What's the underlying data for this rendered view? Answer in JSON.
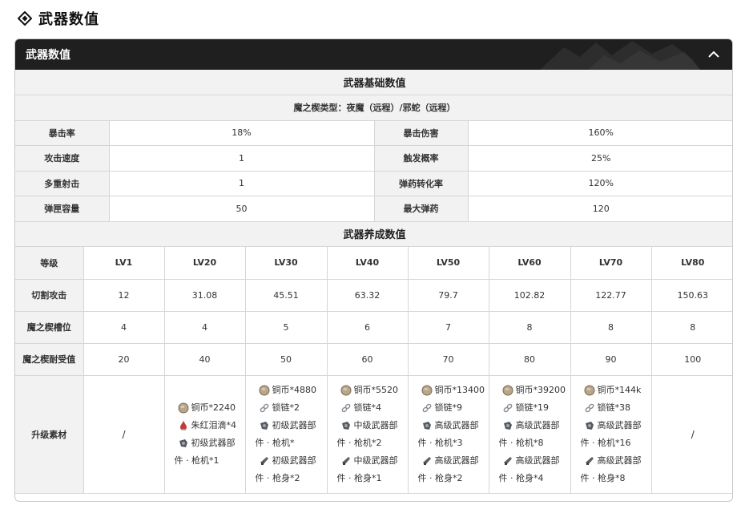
{
  "page": {
    "title": "武器数值"
  },
  "panel": {
    "title": "武器数值",
    "base_section_title": "武器基础数值",
    "type_line": "魔之楔类型：夜魔（远程）/邪蛇（远程）",
    "base_stats": [
      {
        "left_label": "暴击率",
        "left_value": "18%",
        "right_label": "暴击伤害",
        "right_value": "160%"
      },
      {
        "left_label": "攻击速度",
        "left_value": "1",
        "right_label": "触发概率",
        "right_value": "25%"
      },
      {
        "left_label": "多重射击",
        "left_value": "1",
        "right_label": "弹药转化率",
        "right_value": "120%"
      },
      {
        "left_label": "弹匣容量",
        "left_value": "50",
        "right_label": "最大弹药",
        "right_value": "120"
      }
    ],
    "growth_section_title": "武器养成数值",
    "growth": {
      "level_label": "等级",
      "levels": [
        "LV1",
        "LV20",
        "LV30",
        "LV40",
        "LV50",
        "LV60",
        "LV70",
        "LV80"
      ],
      "rows": [
        {
          "label": "切割攻击",
          "values": [
            "12",
            "31.08",
            "45.51",
            "63.32",
            "79.7",
            "102.82",
            "122.77",
            "150.63"
          ]
        },
        {
          "label": "魔之楔槽位",
          "values": [
            "4",
            "4",
            "5",
            "6",
            "7",
            "8",
            "8",
            "8"
          ]
        },
        {
          "label": "魔之楔耐受值",
          "values": [
            "20",
            "40",
            "50",
            "60",
            "70",
            "80",
            "90",
            "100"
          ]
        }
      ],
      "materials_label": "升级素材",
      "materials": [
        {
          "empty": "/"
        },
        {
          "items": [
            {
              "icon": "coin-icon",
              "text": "铜币*2240"
            },
            {
              "icon": "red-tear-icon",
              "text": "朱红泪滴*4"
            },
            {
              "icon": "trigger-part-icon",
              "text": "初级武器部",
              "text2": "件 · 枪机*1"
            }
          ]
        },
        {
          "items": [
            {
              "icon": "coin-icon",
              "text": "铜币*4880"
            },
            {
              "icon": "chain-icon",
              "text": "锁链*2"
            },
            {
              "icon": "trigger-part-icon",
              "text": "初级武器部",
              "text2": "件 · 枪机*"
            },
            {
              "icon": "barrel-part-icon",
              "text": "初级武器部",
              "text2": "件 · 枪身*2"
            }
          ]
        },
        {
          "items": [
            {
              "icon": "coin-icon",
              "text": "铜币*5520"
            },
            {
              "icon": "chain-icon",
              "text": "锁链*4"
            },
            {
              "icon": "trigger-part-icon",
              "text": "中级武器部",
              "text2": "件 · 枪机*2"
            },
            {
              "icon": "barrel-part-icon",
              "text": "中级武器部",
              "text2": "件 · 枪身*1"
            }
          ]
        },
        {
          "items": [
            {
              "icon": "coin-icon",
              "text": "铜币*13400"
            },
            {
              "icon": "chain-icon",
              "text": "锁链*9"
            },
            {
              "icon": "trigger-part-icon",
              "text": "高级武器部",
              "text2": "件 · 枪机*3"
            },
            {
              "icon": "barrel-part-icon",
              "text": "高级武器部",
              "text2": "件 · 枪身*2"
            }
          ]
        },
        {
          "items": [
            {
              "icon": "coin-icon",
              "text": "铜币*39200"
            },
            {
              "icon": "chain-icon",
              "text": "锁链*19"
            },
            {
              "icon": "trigger-part-icon",
              "text": "高级武器部",
              "text2": "件 · 枪机*8"
            },
            {
              "icon": "barrel-part-icon",
              "text": "高级武器部",
              "text2": "件 · 枪身*4"
            }
          ]
        },
        {
          "items": [
            {
              "icon": "coin-icon",
              "text": "铜币*144k"
            },
            {
              "icon": "chain-icon",
              "text": "锁链*38"
            },
            {
              "icon": "trigger-part-icon",
              "text": "高级武器部",
              "text2": "件 · 枪机*16"
            },
            {
              "icon": "barrel-part-icon",
              "text": "高级武器部",
              "text2": "件 · 枪身*8"
            }
          ]
        },
        {
          "empty": "/"
        }
      ]
    }
  },
  "colors": {
    "header_bg": "#1f1f1f",
    "label_bg": "#f2f2f2",
    "border": "#d6d6d6"
  }
}
